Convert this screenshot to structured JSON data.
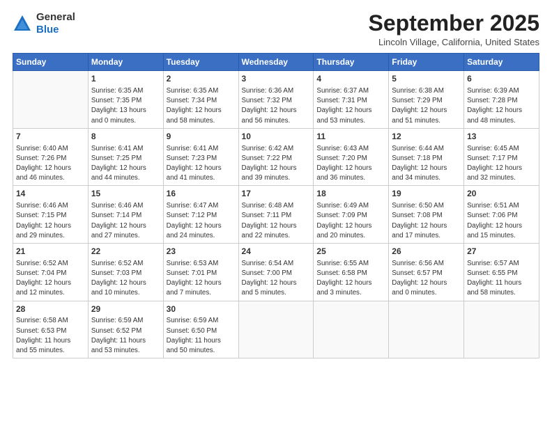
{
  "header": {
    "logo_line1": "General",
    "logo_line2": "Blue",
    "month_title": "September 2025",
    "subtitle": "Lincoln Village, California, United States"
  },
  "days_of_week": [
    "Sunday",
    "Monday",
    "Tuesday",
    "Wednesday",
    "Thursday",
    "Friday",
    "Saturday"
  ],
  "weeks": [
    [
      {
        "day": "",
        "info": ""
      },
      {
        "day": "1",
        "info": "Sunrise: 6:35 AM\nSunset: 7:35 PM\nDaylight: 13 hours\nand 0 minutes."
      },
      {
        "day": "2",
        "info": "Sunrise: 6:35 AM\nSunset: 7:34 PM\nDaylight: 12 hours\nand 58 minutes."
      },
      {
        "day": "3",
        "info": "Sunrise: 6:36 AM\nSunset: 7:32 PM\nDaylight: 12 hours\nand 56 minutes."
      },
      {
        "day": "4",
        "info": "Sunrise: 6:37 AM\nSunset: 7:31 PM\nDaylight: 12 hours\nand 53 minutes."
      },
      {
        "day": "5",
        "info": "Sunrise: 6:38 AM\nSunset: 7:29 PM\nDaylight: 12 hours\nand 51 minutes."
      },
      {
        "day": "6",
        "info": "Sunrise: 6:39 AM\nSunset: 7:28 PM\nDaylight: 12 hours\nand 48 minutes."
      }
    ],
    [
      {
        "day": "7",
        "info": "Sunrise: 6:40 AM\nSunset: 7:26 PM\nDaylight: 12 hours\nand 46 minutes."
      },
      {
        "day": "8",
        "info": "Sunrise: 6:41 AM\nSunset: 7:25 PM\nDaylight: 12 hours\nand 44 minutes."
      },
      {
        "day": "9",
        "info": "Sunrise: 6:41 AM\nSunset: 7:23 PM\nDaylight: 12 hours\nand 41 minutes."
      },
      {
        "day": "10",
        "info": "Sunrise: 6:42 AM\nSunset: 7:22 PM\nDaylight: 12 hours\nand 39 minutes."
      },
      {
        "day": "11",
        "info": "Sunrise: 6:43 AM\nSunset: 7:20 PM\nDaylight: 12 hours\nand 36 minutes."
      },
      {
        "day": "12",
        "info": "Sunrise: 6:44 AM\nSunset: 7:18 PM\nDaylight: 12 hours\nand 34 minutes."
      },
      {
        "day": "13",
        "info": "Sunrise: 6:45 AM\nSunset: 7:17 PM\nDaylight: 12 hours\nand 32 minutes."
      }
    ],
    [
      {
        "day": "14",
        "info": "Sunrise: 6:46 AM\nSunset: 7:15 PM\nDaylight: 12 hours\nand 29 minutes."
      },
      {
        "day": "15",
        "info": "Sunrise: 6:46 AM\nSunset: 7:14 PM\nDaylight: 12 hours\nand 27 minutes."
      },
      {
        "day": "16",
        "info": "Sunrise: 6:47 AM\nSunset: 7:12 PM\nDaylight: 12 hours\nand 24 minutes."
      },
      {
        "day": "17",
        "info": "Sunrise: 6:48 AM\nSunset: 7:11 PM\nDaylight: 12 hours\nand 22 minutes."
      },
      {
        "day": "18",
        "info": "Sunrise: 6:49 AM\nSunset: 7:09 PM\nDaylight: 12 hours\nand 20 minutes."
      },
      {
        "day": "19",
        "info": "Sunrise: 6:50 AM\nSunset: 7:08 PM\nDaylight: 12 hours\nand 17 minutes."
      },
      {
        "day": "20",
        "info": "Sunrise: 6:51 AM\nSunset: 7:06 PM\nDaylight: 12 hours\nand 15 minutes."
      }
    ],
    [
      {
        "day": "21",
        "info": "Sunrise: 6:52 AM\nSunset: 7:04 PM\nDaylight: 12 hours\nand 12 minutes."
      },
      {
        "day": "22",
        "info": "Sunrise: 6:52 AM\nSunset: 7:03 PM\nDaylight: 12 hours\nand 10 minutes."
      },
      {
        "day": "23",
        "info": "Sunrise: 6:53 AM\nSunset: 7:01 PM\nDaylight: 12 hours\nand 7 minutes."
      },
      {
        "day": "24",
        "info": "Sunrise: 6:54 AM\nSunset: 7:00 PM\nDaylight: 12 hours\nand 5 minutes."
      },
      {
        "day": "25",
        "info": "Sunrise: 6:55 AM\nSunset: 6:58 PM\nDaylight: 12 hours\nand 3 minutes."
      },
      {
        "day": "26",
        "info": "Sunrise: 6:56 AM\nSunset: 6:57 PM\nDaylight: 12 hours\nand 0 minutes."
      },
      {
        "day": "27",
        "info": "Sunrise: 6:57 AM\nSunset: 6:55 PM\nDaylight: 11 hours\nand 58 minutes."
      }
    ],
    [
      {
        "day": "28",
        "info": "Sunrise: 6:58 AM\nSunset: 6:53 PM\nDaylight: 11 hours\nand 55 minutes."
      },
      {
        "day": "29",
        "info": "Sunrise: 6:59 AM\nSunset: 6:52 PM\nDaylight: 11 hours\nand 53 minutes."
      },
      {
        "day": "30",
        "info": "Sunrise: 6:59 AM\nSunset: 6:50 PM\nDaylight: 11 hours\nand 50 minutes."
      },
      {
        "day": "",
        "info": ""
      },
      {
        "day": "",
        "info": ""
      },
      {
        "day": "",
        "info": ""
      },
      {
        "day": "",
        "info": ""
      }
    ]
  ]
}
